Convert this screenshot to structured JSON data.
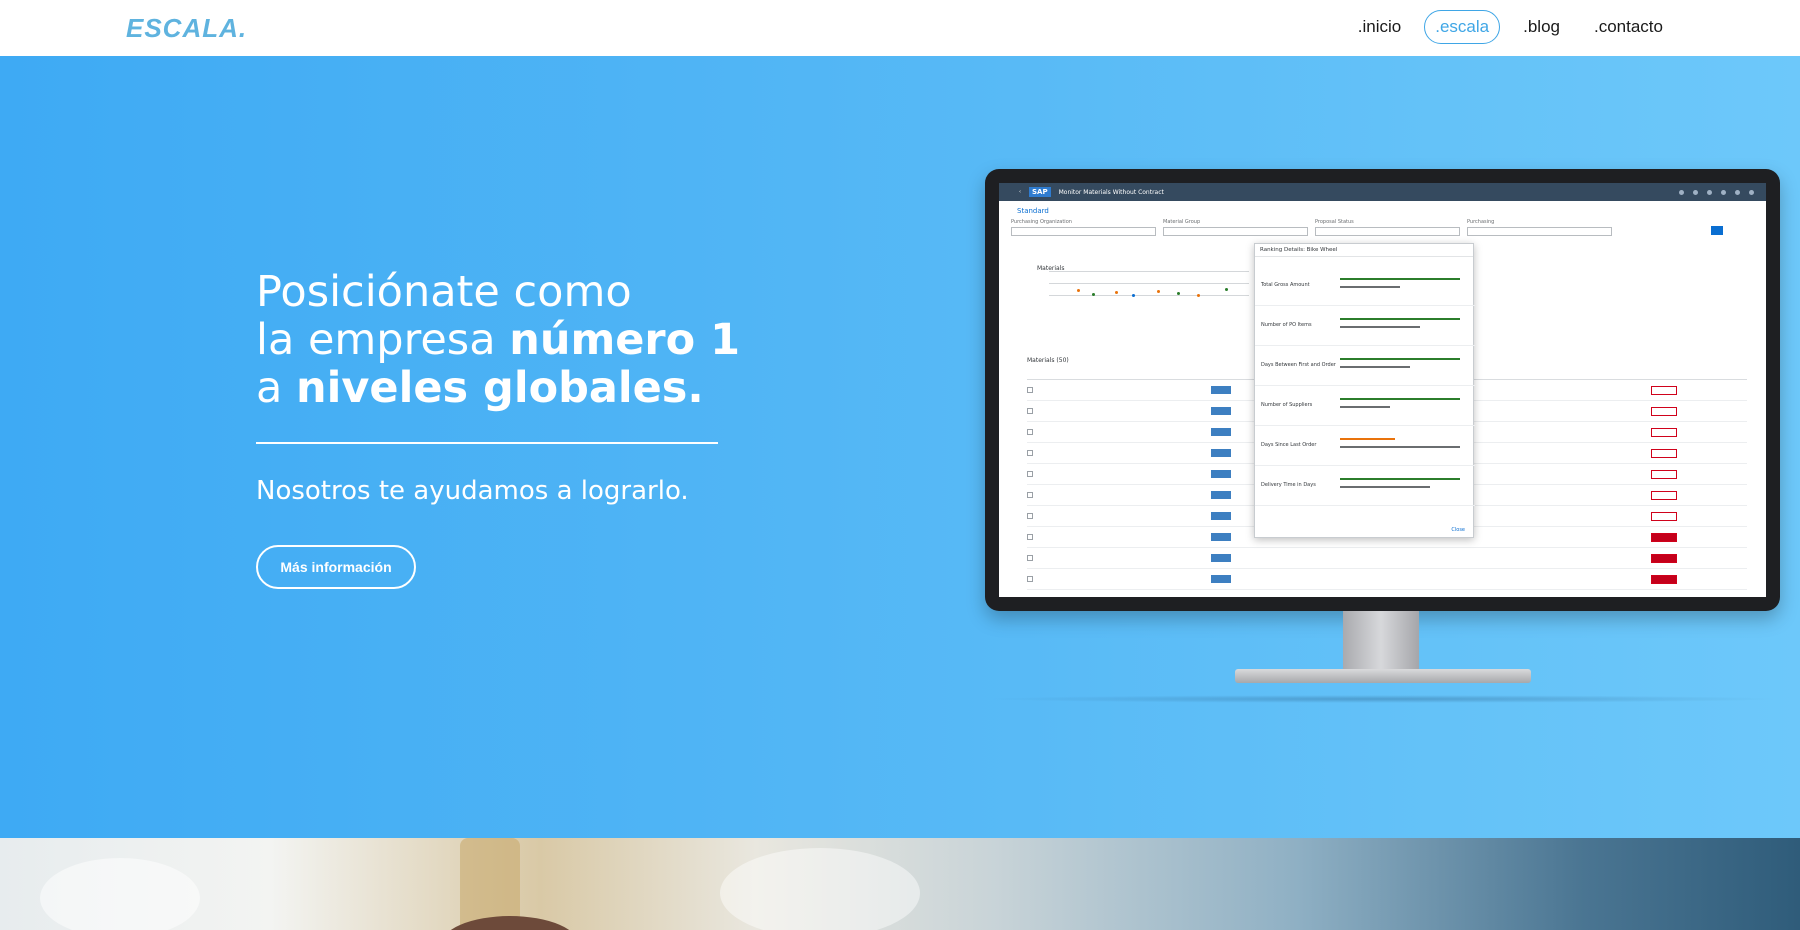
{
  "header": {
    "logo_text": "ESCALA.",
    "nav": [
      {
        "label": ".inicio",
        "active": false
      },
      {
        "label": ".escala",
        "active": true
      },
      {
        "label": ".blog",
        "active": false
      },
      {
        "label": ".contacto",
        "active": false
      }
    ]
  },
  "hero": {
    "headline_line1": "Posiciónate como",
    "headline_line2_regular": "la empresa ",
    "headline_line2_bold": "número 1",
    "headline_line3_regular": "a ",
    "headline_line3_bold": "niveles globales.",
    "subline": "Nosotros te ayudamos a lograrlo.",
    "cta_label": "Más información"
  },
  "screen": {
    "brand": "SAP",
    "app_title": "Monitor Materials Without Contract",
    "variant": "Standard",
    "filters": [
      "Purchasing Organization",
      "Material Group",
      "Proposal Status",
      "Purchasing"
    ],
    "chart_title": "Materials",
    "table_title": "Materials (50)",
    "popover_title": "Ranking Details: Bike Wheel",
    "popover_close": "Close",
    "popover_rows": [
      "Total Gross Amount",
      "Number of PO Items",
      "Days Between First and Order",
      "Number of Suppliers",
      "Days Since Last Order",
      "Delivery Time in Days"
    ]
  },
  "colors": {
    "hero_start": "#3eaaf4",
    "hero_end": "#6dc8fa",
    "nav_active": "#3fa6e6",
    "logo": "#5fb3df"
  }
}
